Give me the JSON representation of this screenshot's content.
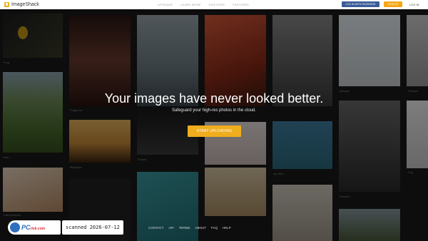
{
  "nav": {
    "brand": "ImageShack",
    "links": [
      "UPGRADE",
      "LEARN MORE",
      "DISCOVER",
      "FEATURED"
    ],
    "facebook_login": "LOG IN WITH FACEBOOK",
    "signup": "SIGN UP",
    "login": "LOG IN"
  },
  "hero": {
    "title": "Your images have never looked better.",
    "subtitle": "Safeguard your high-res photos in the cloud.",
    "cta": "START UPLOADING"
  },
  "gallery_captions": {
    "frog": "Frog",
    "seaside": "Seaside",
    "river": "river",
    "portrait": "Fragment",
    "cyclists": "Bicyclists",
    "sunset": "Sunset",
    "mosque": "Mosque",
    "skydive": "sky dive",
    "building": "Parapet",
    "car": "Porsche",
    "city": "City",
    "cute": "Little Muscles"
  },
  "footer": {
    "links": [
      "CONTACT",
      "API",
      "TERMS",
      "ABOUT",
      "FAQ",
      "HELP"
    ]
  },
  "watermark": {
    "brand_main": "PC",
    "brand_sub": "risk.com",
    "note": "scanned 2026-07-12"
  },
  "colors": {
    "facebook": "#3b5c98",
    "signup": "#f5a817",
    "cta": "#f0ad1e"
  }
}
